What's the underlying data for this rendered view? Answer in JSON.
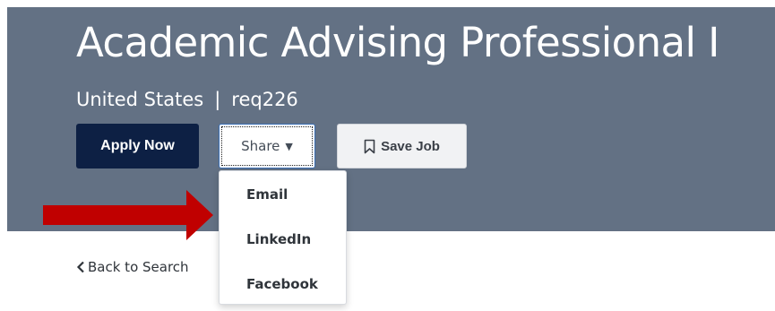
{
  "job": {
    "title": "Academic Advising Professional I",
    "location": "United States",
    "separator": "|",
    "req_id": "req226"
  },
  "actions": {
    "apply_label": "Apply Now",
    "share_label": "Share",
    "save_label": "Save Job"
  },
  "share_menu": {
    "expanded": true,
    "items": [
      "Email",
      "LinkedIn",
      "Facebook"
    ]
  },
  "nav": {
    "back_label": "Back to Search"
  },
  "annotation": {
    "arrow_color": "#c00000",
    "points_to": "share-menu-item-email"
  },
  "colors": {
    "hero_bg": "#637184",
    "apply_bg": "#0d2044",
    "share_border": "#3a6fb5"
  }
}
